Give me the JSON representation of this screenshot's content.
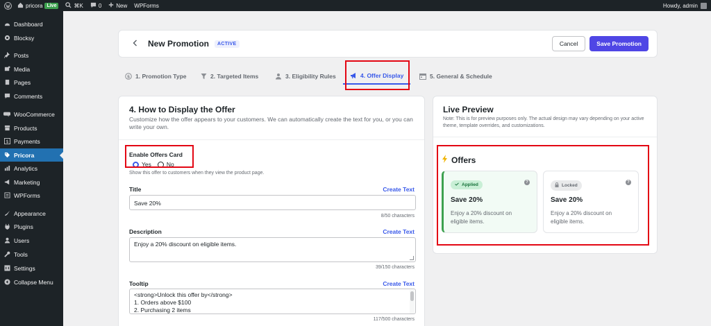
{
  "adminbar": {
    "site_name": "pricora",
    "live_badge": "Live",
    "shortcut": "⌘K",
    "comments_count": "0",
    "new_label": "New",
    "wpforms_label": "WPForms",
    "howdy": "Howdy, admin"
  },
  "sidebar": {
    "items": [
      {
        "label": "Dashboard",
        "icon": "dashboard-icon"
      },
      {
        "label": "Blocksy",
        "icon": "blocksy-icon"
      },
      {
        "label": "Posts",
        "icon": "pin-icon"
      },
      {
        "label": "Media",
        "icon": "media-icon"
      },
      {
        "label": "Pages",
        "icon": "page-icon"
      },
      {
        "label": "Comments",
        "icon": "comment-icon"
      },
      {
        "label": "WooCommerce",
        "icon": "woo-icon"
      },
      {
        "label": "Products",
        "icon": "archive-icon"
      },
      {
        "label": "Payments",
        "icon": "dollar-icon"
      },
      {
        "label": "Pricora",
        "icon": "tag-icon",
        "active": true
      },
      {
        "label": "Analytics",
        "icon": "bar-chart-icon"
      },
      {
        "label": "Marketing",
        "icon": "megaphone-icon"
      },
      {
        "label": "WPForms",
        "icon": "forms-icon"
      },
      {
        "label": "Appearance",
        "icon": "brush-icon"
      },
      {
        "label": "Plugins",
        "icon": "plug-icon"
      },
      {
        "label": "Users",
        "icon": "user-icon"
      },
      {
        "label": "Tools",
        "icon": "wrench-icon"
      },
      {
        "label": "Settings",
        "icon": "settings-icon"
      },
      {
        "label": "Collapse Menu",
        "icon": "collapse-icon"
      }
    ]
  },
  "header": {
    "title": "New Promotion",
    "status": "ACTIVE",
    "cancel_label": "Cancel",
    "save_label": "Save Promotion"
  },
  "tabs": [
    {
      "label": "1. Promotion Type",
      "icon": "dollar-circle-icon"
    },
    {
      "label": "2. Targeted Items",
      "icon": "filter-icon"
    },
    {
      "label": "3. Eligibility Rules",
      "icon": "user-group-icon"
    },
    {
      "label": "4. Offer Display",
      "icon": "megaphone-icon",
      "active": true
    },
    {
      "label": "5. General & Schedule",
      "icon": "calendar-icon"
    }
  ],
  "form": {
    "title": "4. How to Display the Offer",
    "description": "Customize how the offer appears to your customers. We can automatically create the text for you, or you can write your own.",
    "enable_label": "Enable Offers Card",
    "yes_label": "Yes",
    "no_label": "No",
    "enable_helper": "Show this offer to customers when they view the product page.",
    "create_text_label": "Create Text",
    "title_label": "Title",
    "title_value": "Save 20%",
    "title_counter": "8/50 characters",
    "description_label": "Description",
    "description_value": "Enjoy a 20% discount on eligible items.",
    "description_counter": "39/150 characters",
    "tooltip_label": "Tooltip",
    "tooltip_lines": [
      "<strong>Unlock this offer by</strong>",
      "1. Orders above $100",
      "2. Purchasing 2 items"
    ],
    "tooltip_counter": "117/500 characters"
  },
  "preview": {
    "title": "Live Preview",
    "note": "Note: This is for preview purposes only. The actual design may vary depending on your active theme, template overrides, and customizations.",
    "offers_heading": "Offers",
    "cards": [
      {
        "status": "Applied",
        "name": "Save 20%",
        "desc": "Enjoy a 20% discount on eligible items."
      },
      {
        "status": "Locked",
        "name": "Save 20%",
        "desc": "Enjoy a 20% discount on eligible items."
      }
    ]
  },
  "colors": {
    "accent": "#3858e9",
    "primary_button": "#4f46e5",
    "applied_green": "#3da14f",
    "highlight_red": "#e30613",
    "admin_dark": "#1d2327"
  }
}
